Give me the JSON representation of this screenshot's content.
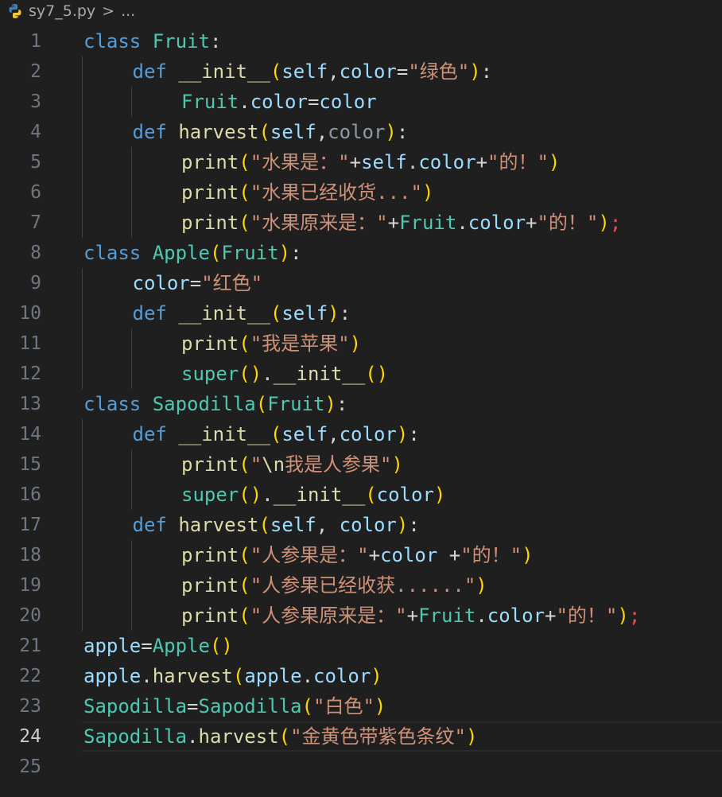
{
  "breadcrumb": {
    "filename": "sy7_5.py",
    "separator": ">",
    "ellipsis": "..."
  },
  "colors": {
    "background": "#1f1f1f",
    "keyword": "#569cd6",
    "class_name": "#4ec9b0",
    "function": "#dcdcaa",
    "variable": "#9cdcfe",
    "string": "#ce9178",
    "bracket": "#ffd700",
    "error": "#f14c4c"
  },
  "editor": {
    "current_line": 24,
    "lines": [
      {
        "n": "1",
        "indent": 0,
        "tokens": [
          [
            "kw",
            "class"
          ],
          [
            "op",
            " "
          ],
          [
            "cls",
            "Fruit"
          ],
          [
            "op",
            ":"
          ]
        ]
      },
      {
        "n": "2",
        "indent": 1,
        "tokens": [
          [
            "kw",
            "def"
          ],
          [
            "op",
            " "
          ],
          [
            "fn",
            "__init__"
          ],
          [
            "br1",
            "("
          ],
          [
            "var",
            "self"
          ],
          [
            "op",
            ","
          ],
          [
            "var",
            "color"
          ],
          [
            "op",
            "="
          ],
          [
            "str",
            "\"绿色\""
          ],
          [
            "br1",
            ")"
          ],
          [
            "op",
            ":"
          ]
        ]
      },
      {
        "n": "3",
        "indent": 2,
        "tokens": [
          [
            "cls",
            "Fruit"
          ],
          [
            "op",
            "."
          ],
          [
            "var",
            "color"
          ],
          [
            "op",
            "="
          ],
          [
            "var",
            "color"
          ]
        ]
      },
      {
        "n": "4",
        "indent": 1,
        "tokens": [
          [
            "kw",
            "def"
          ],
          [
            "op",
            " "
          ],
          [
            "fn",
            "harvest"
          ],
          [
            "br1",
            "("
          ],
          [
            "var",
            "self"
          ],
          [
            "op",
            ","
          ],
          [
            "dim",
            "color"
          ],
          [
            "br1",
            ")"
          ],
          [
            "op",
            ":"
          ]
        ]
      },
      {
        "n": "5",
        "indent": 2,
        "tokens": [
          [
            "fn",
            "print"
          ],
          [
            "br1",
            "("
          ],
          [
            "str",
            "\"水果是：\""
          ],
          [
            "op",
            "+"
          ],
          [
            "var",
            "self"
          ],
          [
            "op",
            "."
          ],
          [
            "var",
            "color"
          ],
          [
            "op",
            "+"
          ],
          [
            "str",
            "\"的！\""
          ],
          [
            "br1",
            ")"
          ]
        ]
      },
      {
        "n": "6",
        "indent": 2,
        "tokens": [
          [
            "fn",
            "print"
          ],
          [
            "br1",
            "("
          ],
          [
            "str",
            "\"水果已经收货...\""
          ],
          [
            "br1",
            ")"
          ]
        ]
      },
      {
        "n": "7",
        "indent": 2,
        "tokens": [
          [
            "fn",
            "print"
          ],
          [
            "br1",
            "("
          ],
          [
            "str",
            "\"水果原来是：\""
          ],
          [
            "op",
            "+"
          ],
          [
            "cls",
            "Fruit"
          ],
          [
            "op",
            "."
          ],
          [
            "var",
            "color"
          ],
          [
            "op",
            "+"
          ],
          [
            "str",
            "\"的！\""
          ],
          [
            "br1",
            ")"
          ],
          [
            "err",
            ";"
          ]
        ]
      },
      {
        "n": "8",
        "indent": 0,
        "tokens": [
          [
            "kw",
            "class"
          ],
          [
            "op",
            " "
          ],
          [
            "cls",
            "Apple"
          ],
          [
            "br1",
            "("
          ],
          [
            "cls",
            "Fruit"
          ],
          [
            "br1",
            ")"
          ],
          [
            "op",
            ":"
          ]
        ]
      },
      {
        "n": "9",
        "indent": 1,
        "tokens": [
          [
            "var",
            "color"
          ],
          [
            "op",
            "="
          ],
          [
            "str",
            "\"红色\""
          ]
        ]
      },
      {
        "n": "10",
        "indent": 1,
        "tokens": [
          [
            "kw",
            "def"
          ],
          [
            "op",
            " "
          ],
          [
            "fn",
            "__init__"
          ],
          [
            "br1",
            "("
          ],
          [
            "var",
            "self"
          ],
          [
            "br1",
            ")"
          ],
          [
            "op",
            ":"
          ]
        ]
      },
      {
        "n": "11",
        "indent": 2,
        "tokens": [
          [
            "fn",
            "print"
          ],
          [
            "br1",
            "("
          ],
          [
            "str",
            "\"我是苹果\""
          ],
          [
            "br1",
            ")"
          ]
        ]
      },
      {
        "n": "12",
        "indent": 2,
        "tokens": [
          [
            "cls",
            "super"
          ],
          [
            "br1",
            "()"
          ],
          [
            "op",
            "."
          ],
          [
            "fn",
            "__init__"
          ],
          [
            "br1",
            "()"
          ]
        ]
      },
      {
        "n": "13",
        "indent": 0,
        "tokens": [
          [
            "kw",
            "class"
          ],
          [
            "op",
            " "
          ],
          [
            "cls",
            "Sapodilla"
          ],
          [
            "br1",
            "("
          ],
          [
            "cls",
            "Fruit"
          ],
          [
            "br1",
            ")"
          ],
          [
            "op",
            ":"
          ]
        ]
      },
      {
        "n": "14",
        "indent": 1,
        "tokens": [
          [
            "kw",
            "def"
          ],
          [
            "op",
            " "
          ],
          [
            "fn",
            "__init__"
          ],
          [
            "br1",
            "("
          ],
          [
            "var",
            "self"
          ],
          [
            "op",
            ","
          ],
          [
            "var",
            "color"
          ],
          [
            "br1",
            ")"
          ],
          [
            "op",
            ":"
          ]
        ]
      },
      {
        "n": "15",
        "indent": 2,
        "tokens": [
          [
            "fn",
            "print"
          ],
          [
            "br1",
            "("
          ],
          [
            "str",
            "\""
          ],
          [
            "fn",
            "\\n"
          ],
          [
            "str",
            "我是人参果\""
          ],
          [
            "br1",
            ")"
          ]
        ]
      },
      {
        "n": "16",
        "indent": 2,
        "tokens": [
          [
            "cls",
            "super"
          ],
          [
            "br1",
            "()"
          ],
          [
            "op",
            "."
          ],
          [
            "fn",
            "__init__"
          ],
          [
            "br1",
            "("
          ],
          [
            "var",
            "color"
          ],
          [
            "br1",
            ")"
          ]
        ]
      },
      {
        "n": "17",
        "indent": 1,
        "tokens": [
          [
            "kw",
            "def"
          ],
          [
            "op",
            " "
          ],
          [
            "fn",
            "harvest"
          ],
          [
            "br1",
            "("
          ],
          [
            "var",
            "self"
          ],
          [
            "op",
            ", "
          ],
          [
            "var",
            "color"
          ],
          [
            "br1",
            ")"
          ],
          [
            "op",
            ":"
          ]
        ]
      },
      {
        "n": "18",
        "indent": 2,
        "tokens": [
          [
            "fn",
            "print"
          ],
          [
            "br1",
            "("
          ],
          [
            "str",
            "\"人参果是：\""
          ],
          [
            "op",
            "+"
          ],
          [
            "var",
            "color"
          ],
          [
            "op",
            " +"
          ],
          [
            "str",
            "\"的！\""
          ],
          [
            "br1",
            ")"
          ]
        ]
      },
      {
        "n": "19",
        "indent": 2,
        "tokens": [
          [
            "fn",
            "print"
          ],
          [
            "br1",
            "("
          ],
          [
            "str",
            "\"人参果已经收获......\""
          ],
          [
            "br1",
            ")"
          ]
        ]
      },
      {
        "n": "20",
        "indent": 2,
        "tokens": [
          [
            "fn",
            "print"
          ],
          [
            "br1",
            "("
          ],
          [
            "str",
            "\"人参果原来是：\""
          ],
          [
            "op",
            "+"
          ],
          [
            "cls",
            "Fruit"
          ],
          [
            "op",
            "."
          ],
          [
            "var",
            "color"
          ],
          [
            "op",
            "+"
          ],
          [
            "str",
            "\"的！\""
          ],
          [
            "br1",
            ")"
          ],
          [
            "err",
            ";"
          ]
        ]
      },
      {
        "n": "21",
        "indent": 0,
        "tokens": [
          [
            "var",
            "apple"
          ],
          [
            "op",
            "="
          ],
          [
            "cls",
            "Apple"
          ],
          [
            "br1",
            "()"
          ]
        ]
      },
      {
        "n": "22",
        "indent": 0,
        "tokens": [
          [
            "var",
            "apple"
          ],
          [
            "op",
            "."
          ],
          [
            "fn",
            "harvest"
          ],
          [
            "br1",
            "("
          ],
          [
            "var",
            "apple"
          ],
          [
            "op",
            "."
          ],
          [
            "var",
            "color"
          ],
          [
            "br1",
            ")"
          ]
        ]
      },
      {
        "n": "23",
        "indent": 0,
        "tokens": [
          [
            "cls",
            "Sapodilla"
          ],
          [
            "op",
            "="
          ],
          [
            "cls",
            "Sapodilla"
          ],
          [
            "br1",
            "("
          ],
          [
            "str",
            "\"白色\""
          ],
          [
            "br1",
            ")"
          ]
        ]
      },
      {
        "n": "24",
        "indent": 0,
        "tokens": [
          [
            "cls",
            "Sapodilla"
          ],
          [
            "op",
            "."
          ],
          [
            "fn",
            "harvest"
          ],
          [
            "br1",
            "("
          ],
          [
            "str",
            "\"金黄色带紫色条纹\""
          ],
          [
            "br1",
            ")"
          ]
        ]
      },
      {
        "n": "25",
        "indent": 0,
        "tokens": []
      }
    ]
  }
}
